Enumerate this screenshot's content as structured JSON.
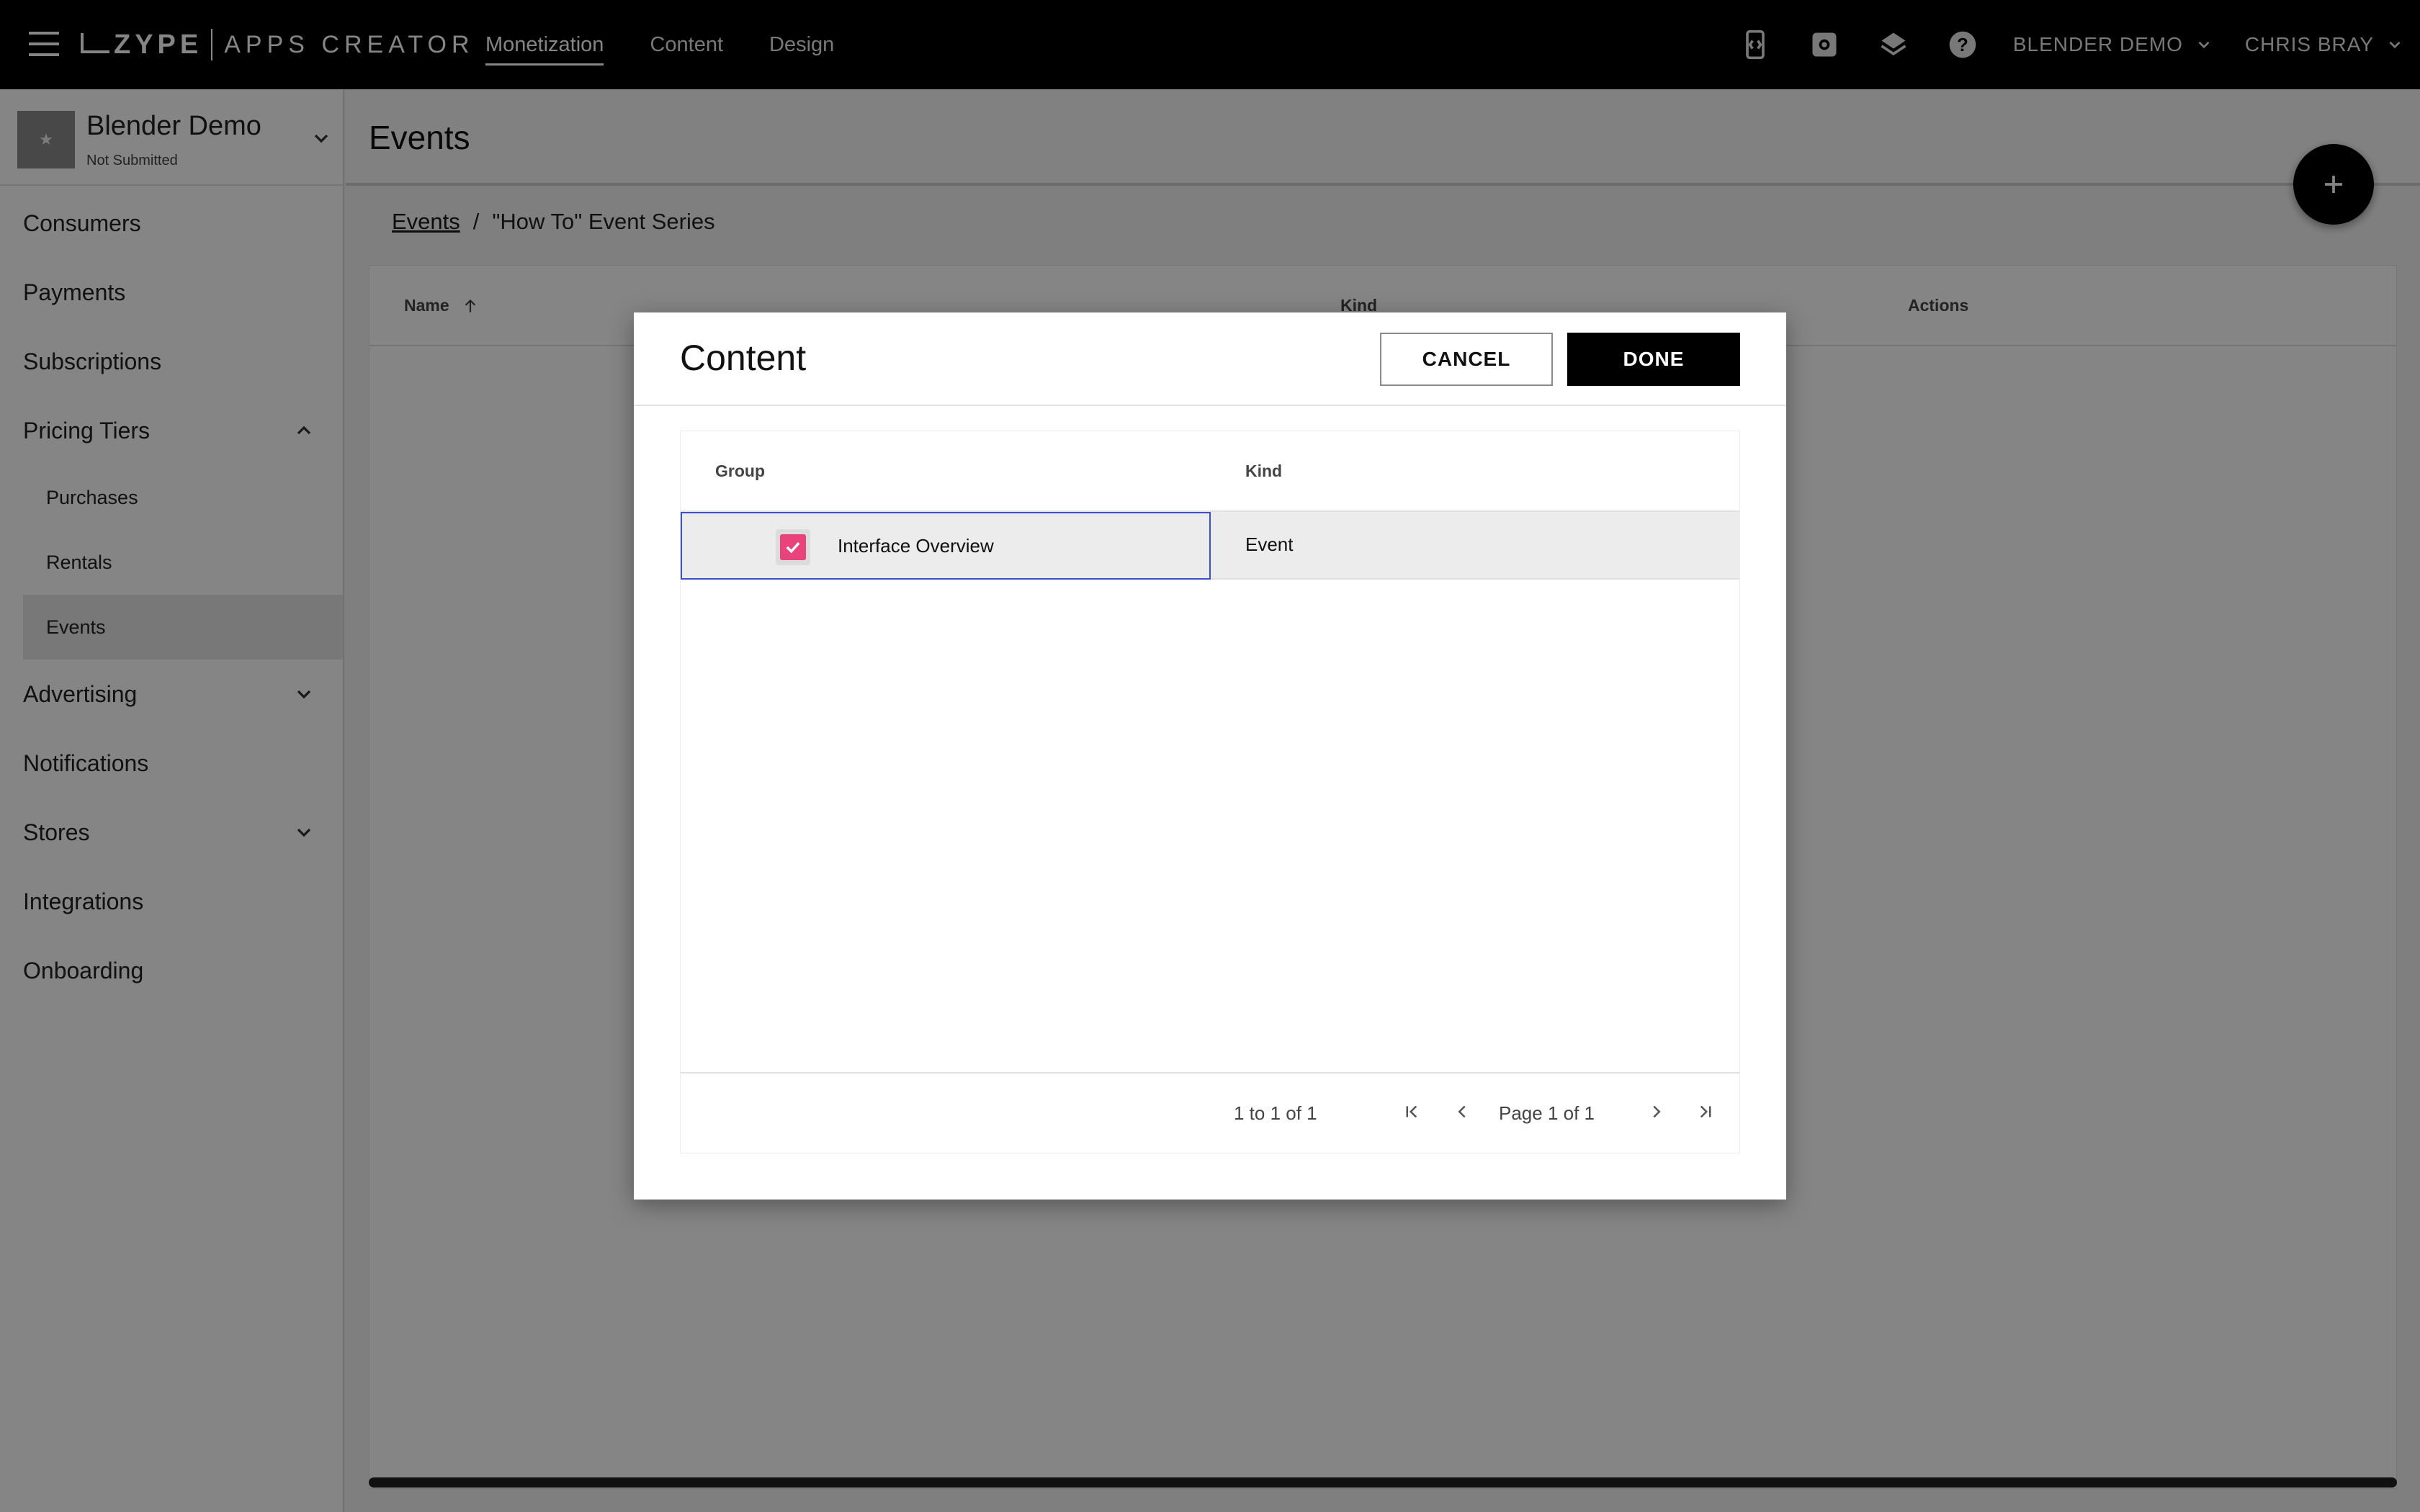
{
  "topbar": {
    "brand": "ZYPE",
    "brand_sub": "APPS CREATOR",
    "nav": [
      "Monetization",
      "Content",
      "Design"
    ],
    "account_menu": "BLENDER DEMO",
    "user_menu": "CHRIS BRAY"
  },
  "sidebar": {
    "app_name": "Blender Demo",
    "app_status": "Not Submitted",
    "items": {
      "consumers": "Consumers",
      "payments": "Payments",
      "subscriptions": "Subscriptions",
      "pricing_tiers": "Pricing Tiers",
      "purchases": "Purchases",
      "rentals": "Rentals",
      "events": "Events",
      "advertising": "Advertising",
      "notifications": "Notifications",
      "stores": "Stores",
      "integrations": "Integrations",
      "onboarding": "Onboarding"
    }
  },
  "main": {
    "title": "Events",
    "breadcrumb": {
      "link": "Events",
      "separator": "/",
      "current": "\"How To\" Event Series"
    },
    "table": {
      "columns": [
        "Name",
        "Kind",
        "Actions"
      ]
    }
  },
  "modal": {
    "title": "Content",
    "cancel_label": "CANCEL",
    "done_label": "DONE",
    "columns": [
      "Group",
      "Kind"
    ],
    "rows": [
      {
        "name": "Interface Overview",
        "kind": "Event",
        "checked": true
      }
    ],
    "pagination": {
      "summary": "1 to 1 of 1",
      "page_text": "Page 1 of 1"
    }
  },
  "colors": {
    "accent_checkbox": "#e8437a",
    "selection_border": "#3b4fd0",
    "topbar": "#000000"
  }
}
